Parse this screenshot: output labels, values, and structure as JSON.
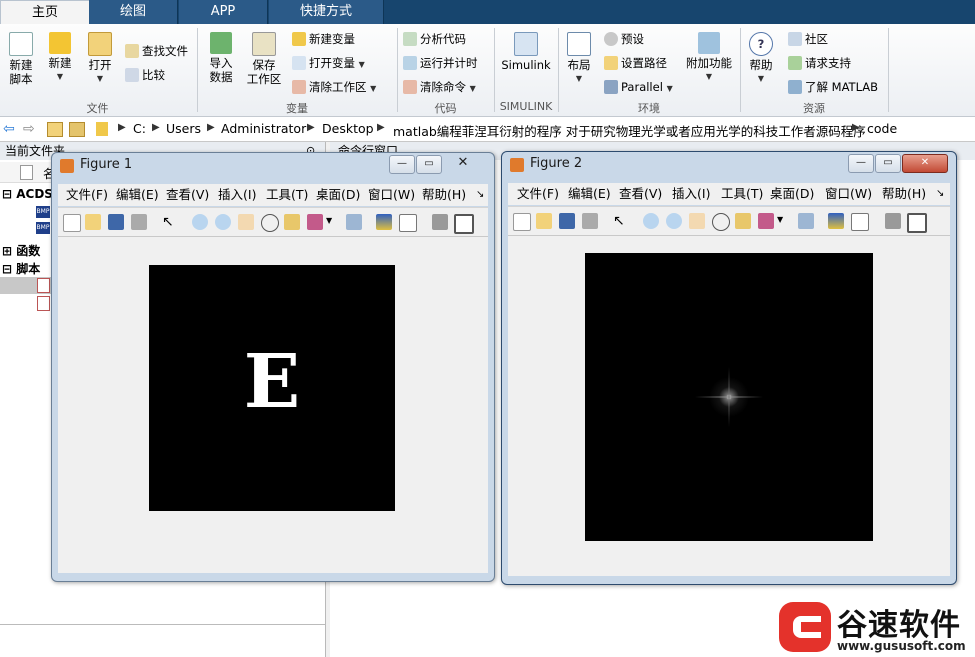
{
  "tabs": [
    "主页",
    "绘图",
    "APP",
    "快捷方式"
  ],
  "ribbon": {
    "file": {
      "new_script": "新建\n脚本",
      "new": "新建",
      "open": "打开",
      "find_files": "查找文件",
      "compare": "比较",
      "group": "文件"
    },
    "variable": {
      "import": "导入\n数据",
      "save_ws": "保存\n工作区",
      "new_var": "新建变量",
      "open_var": "打开变量",
      "clear_ws": "清除工作区",
      "group": "变量"
    },
    "code": {
      "analyze": "分析代码",
      "run_time": "运行并计时",
      "clear_cmd": "清除命令",
      "group": "代码"
    },
    "simulink": {
      "simulink": "Simulink",
      "group": "SIMULINK"
    },
    "env": {
      "layout": "布局",
      "prefs": "预设",
      "set_path": "设置路径",
      "parallel": "Parallel",
      "addons": "附加功能",
      "group": "环境"
    },
    "resources": {
      "help": "帮助",
      "community": "社区",
      "request_support": "请求支持",
      "learn": "了解 MATLAB",
      "group": "资源"
    }
  },
  "address": [
    "C:",
    "Users",
    "Administrator",
    "Desktop",
    "matlab编程菲涅耳衍射的程序 对于研究物理光学或者应用光学的科技工作者源码程序",
    "code"
  ],
  "left_panel": {
    "title": "当前文件夹",
    "col_name": "名",
    "items": [
      "ACDS",
      "函数",
      "脚本"
    ]
  },
  "command_window": {
    "title": "命令行窗口"
  },
  "figure1": {
    "title": "Figure 1",
    "menus": [
      "文件(F)",
      "编辑(E)",
      "查看(V)",
      "插入(I)",
      "工具(T)",
      "桌面(D)",
      "窗口(W)",
      "帮助(H)"
    ],
    "letter": "E"
  },
  "figure2": {
    "title": "Figure 2",
    "menus": [
      "文件(F)",
      "编辑(E)",
      "查看(V)",
      "插入(I)",
      "工具(T)",
      "桌面(D)",
      "窗口(W)",
      "帮助(H)"
    ]
  },
  "watermark": {
    "brand": "谷速软件",
    "url": "www.gususoft.com"
  }
}
